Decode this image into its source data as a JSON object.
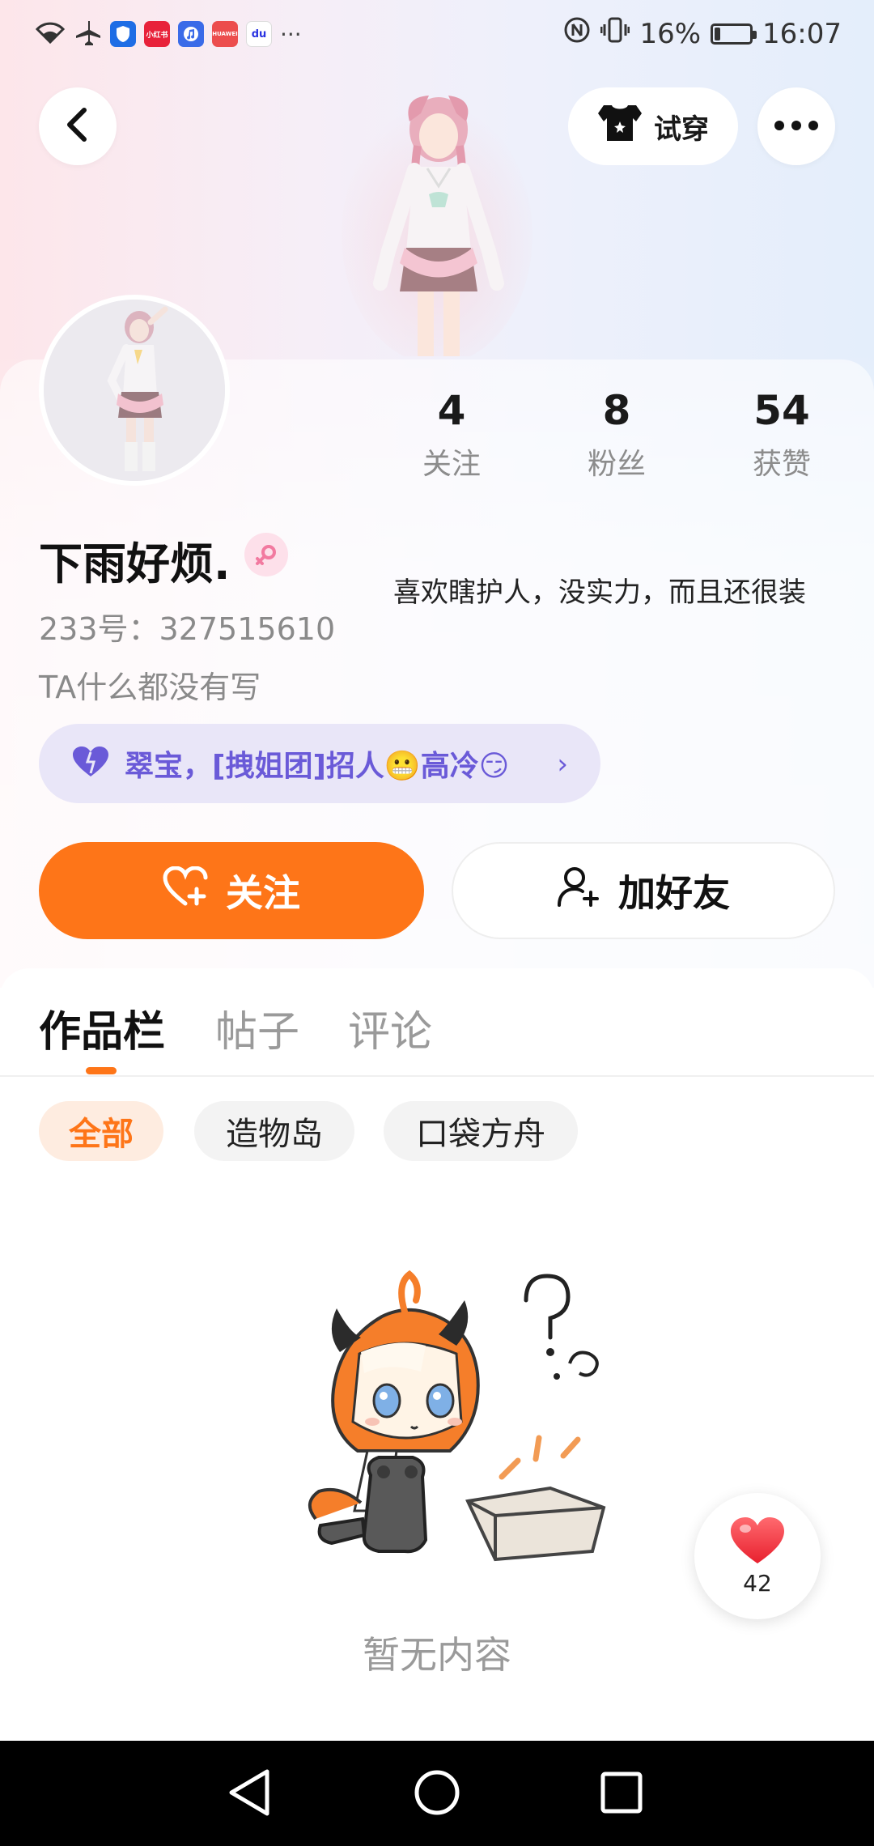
{
  "status_bar": {
    "battery": "16%",
    "battery_level": 0.16,
    "time": "16:07",
    "more": "···",
    "app_icons": [
      {
        "name": "security-app-icon",
        "color": "#1e6de5"
      },
      {
        "name": "xiaohongshu-app-icon",
        "color": "#e8223a",
        "text": "小红书"
      },
      {
        "name": "music-app-icon",
        "color": "#3a6be8"
      },
      {
        "name": "huawei-app-icon",
        "color": "#ec4d4d",
        "text": "HUAWEI"
      },
      {
        "name": "baidu-app-icon",
        "color": "#ffffff",
        "text": "du"
      }
    ]
  },
  "top_bar": {
    "try_on_label": "试穿"
  },
  "profile": {
    "nickname": "下雨好烦.",
    "uid": "233号：327515610",
    "bio": "TA什么都没有写",
    "signature": "喜欢瞎护人，没实力，而且还很装",
    "gender": "female",
    "stats": [
      {
        "value": "4",
        "label": "关注"
      },
      {
        "value": "8",
        "label": "粉丝"
      },
      {
        "value": "54",
        "label": "获赞"
      }
    ],
    "group": {
      "text": "翠宝，[拽姐团]招人😬高冷😏",
      "chevron": "›"
    }
  },
  "actions": {
    "follow_label": "关注",
    "add_friend_label": "加好友"
  },
  "tabs": [
    {
      "label": "作品栏",
      "active": true
    },
    {
      "label": "帖子",
      "active": false
    },
    {
      "label": "评论",
      "active": false
    }
  ],
  "filters": [
    {
      "label": "全部",
      "active": true
    },
    {
      "label": "造物岛",
      "active": false
    },
    {
      "label": "口袋方舟",
      "active": false
    }
  ],
  "empty_state": {
    "text": "暂无内容"
  },
  "like_fab": {
    "count": "42"
  },
  "colors": {
    "accent": "#fe7518",
    "group_purple": "#6a5ad8",
    "like_red": "#f5333f"
  }
}
